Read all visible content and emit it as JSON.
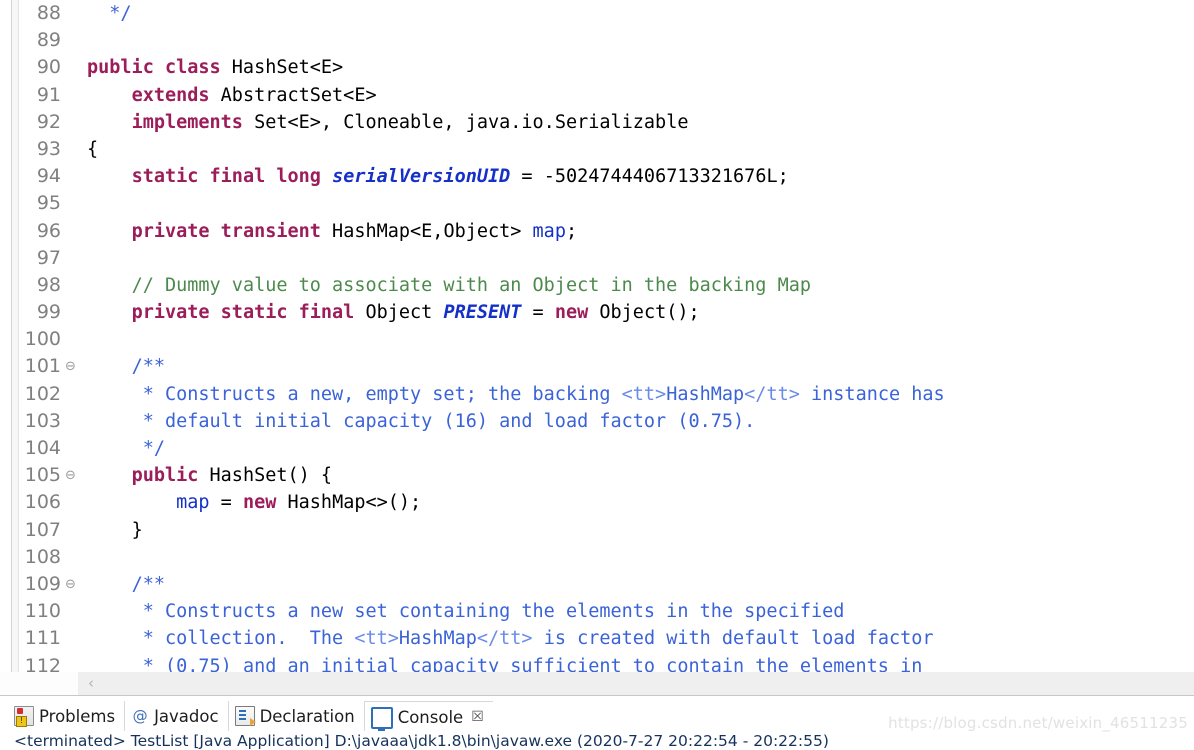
{
  "editor": {
    "first_line": 88,
    "fold_marker": "⊖",
    "lines": [
      {
        "num": "88",
        "fold": false,
        "tokens": [
          {
            "t": "  ",
            "c": "plain"
          },
          {
            "t": "*/",
            "c": "doc"
          }
        ]
      },
      {
        "num": "89",
        "fold": false,
        "tokens": []
      },
      {
        "num": "90",
        "fold": false,
        "tokens": [
          {
            "t": "public class",
            "c": "kw"
          },
          {
            "t": " HashSet<E>",
            "c": "plain"
          }
        ]
      },
      {
        "num": "91",
        "fold": false,
        "tokens": [
          {
            "t": "    ",
            "c": "plain"
          },
          {
            "t": "extends",
            "c": "kw"
          },
          {
            "t": " AbstractSet<E>",
            "c": "plain"
          }
        ]
      },
      {
        "num": "92",
        "fold": false,
        "tokens": [
          {
            "t": "    ",
            "c": "plain"
          },
          {
            "t": "implements",
            "c": "kw"
          },
          {
            "t": " Set<E>, Cloneable, java.io.Serializable",
            "c": "plain"
          }
        ]
      },
      {
        "num": "93",
        "fold": false,
        "tokens": [
          {
            "t": "{",
            "c": "plain"
          }
        ]
      },
      {
        "num": "94",
        "fold": false,
        "tokens": [
          {
            "t": "    ",
            "c": "plain"
          },
          {
            "t": "static final long",
            "c": "kw"
          },
          {
            "t": " ",
            "c": "plain"
          },
          {
            "t": "serialVersionUID",
            "c": "stat"
          },
          {
            "t": " = -5024744406713321676L;",
            "c": "plain"
          }
        ]
      },
      {
        "num": "95",
        "fold": false,
        "tokens": []
      },
      {
        "num": "96",
        "fold": false,
        "tokens": [
          {
            "t": "    ",
            "c": "plain"
          },
          {
            "t": "private transient",
            "c": "kw"
          },
          {
            "t": " HashMap<E,Object> ",
            "c": "plain"
          },
          {
            "t": "map",
            "c": "field"
          },
          {
            "t": ";",
            "c": "plain"
          }
        ]
      },
      {
        "num": "97",
        "fold": false,
        "tokens": []
      },
      {
        "num": "98",
        "fold": false,
        "tokens": [
          {
            "t": "    ",
            "c": "plain"
          },
          {
            "t": "// Dummy value to associate with an Object in the backing Map",
            "c": "cmt"
          }
        ]
      },
      {
        "num": "99",
        "fold": false,
        "tokens": [
          {
            "t": "    ",
            "c": "plain"
          },
          {
            "t": "private static final",
            "c": "kw"
          },
          {
            "t": " Object ",
            "c": "plain"
          },
          {
            "t": "PRESENT",
            "c": "stat"
          },
          {
            "t": " = ",
            "c": "plain"
          },
          {
            "t": "new",
            "c": "kw"
          },
          {
            "t": " Object();",
            "c": "plain"
          }
        ]
      },
      {
        "num": "100",
        "fold": false,
        "tokens": []
      },
      {
        "num": "101",
        "fold": true,
        "tokens": [
          {
            "t": "    ",
            "c": "plain"
          },
          {
            "t": "/**",
            "c": "doc"
          }
        ]
      },
      {
        "num": "102",
        "fold": false,
        "tokens": [
          {
            "t": "     ",
            "c": "plain"
          },
          {
            "t": "* Constructs a new, empty set; the backing ",
            "c": "doc"
          },
          {
            "t": "<tt>",
            "c": "doctag"
          },
          {
            "t": "HashMap",
            "c": "doc"
          },
          {
            "t": "</tt>",
            "c": "doctag"
          },
          {
            "t": " instance has",
            "c": "doc"
          }
        ]
      },
      {
        "num": "103",
        "fold": false,
        "tokens": [
          {
            "t": "     ",
            "c": "plain"
          },
          {
            "t": "* default initial capacity (16) and load factor (0.75).",
            "c": "doc"
          }
        ]
      },
      {
        "num": "104",
        "fold": false,
        "tokens": [
          {
            "t": "     ",
            "c": "plain"
          },
          {
            "t": "*/",
            "c": "doc"
          }
        ]
      },
      {
        "num": "105",
        "fold": true,
        "tokens": [
          {
            "t": "    ",
            "c": "plain"
          },
          {
            "t": "public",
            "c": "kw"
          },
          {
            "t": " HashSet() {",
            "c": "plain"
          }
        ]
      },
      {
        "num": "106",
        "fold": false,
        "tokens": [
          {
            "t": "        ",
            "c": "plain"
          },
          {
            "t": "map",
            "c": "field"
          },
          {
            "t": " = ",
            "c": "plain"
          },
          {
            "t": "new",
            "c": "kw"
          },
          {
            "t": " HashMap<>();",
            "c": "plain"
          }
        ]
      },
      {
        "num": "107",
        "fold": false,
        "tokens": [
          {
            "t": "    ",
            "c": "plain"
          },
          {
            "t": "}",
            "c": "plain"
          }
        ]
      },
      {
        "num": "108",
        "fold": false,
        "tokens": []
      },
      {
        "num": "109",
        "fold": true,
        "tokens": [
          {
            "t": "    ",
            "c": "plain"
          },
          {
            "t": "/**",
            "c": "doc"
          }
        ]
      },
      {
        "num": "110",
        "fold": false,
        "tokens": [
          {
            "t": "     ",
            "c": "plain"
          },
          {
            "t": "* Constructs a new set containing the elements in the specified",
            "c": "doc"
          }
        ]
      },
      {
        "num": "111",
        "fold": false,
        "tokens": [
          {
            "t": "     ",
            "c": "plain"
          },
          {
            "t": "* collection.  The ",
            "c": "doc"
          },
          {
            "t": "<tt>",
            "c": "doctag"
          },
          {
            "t": "HashMap",
            "c": "doc"
          },
          {
            "t": "</tt>",
            "c": "doctag"
          },
          {
            "t": " is created with default load factor",
            "c": "doc"
          }
        ]
      },
      {
        "num": "112",
        "fold": false,
        "tokens": [
          {
            "t": "     ",
            "c": "plain"
          },
          {
            "t": "* (0.75) and an initial capacity sufficient to contain the elements in",
            "c": "doc"
          }
        ]
      }
    ]
  },
  "scrollbar": {
    "left_arrow": "‹"
  },
  "bottom_panel": {
    "tabs": [
      {
        "label": "Problems",
        "icon": "problems-icon",
        "active": false,
        "closable": false
      },
      {
        "label": "Javadoc",
        "icon": "javadoc-icon",
        "active": false,
        "closable": false
      },
      {
        "label": "Declaration",
        "icon": "declaration-icon",
        "active": false,
        "closable": false
      },
      {
        "label": "Console",
        "icon": "console-icon",
        "active": true,
        "closable": true
      }
    ],
    "close_glyph": "☒",
    "console_line": "<terminated> TestList [Java Application] D:\\javaaa\\jdk1.8\\bin\\javaw.exe (2020-7-27 20:22:54 - 20:22:55)"
  },
  "watermark": {
    "text": "https://blog.csdn.net/weixin_46511235"
  },
  "colors": {
    "keyword": "#9b1d5a",
    "comment": "#4c8a4c",
    "javadoc": "#3b63d8",
    "javadoc_tag": "#6a8ce8",
    "field": "#1430c7",
    "static_field": "#1430c7",
    "line_number": "#808080",
    "editor_bg": "#ffffff",
    "watermark": "#e2e2e2"
  }
}
